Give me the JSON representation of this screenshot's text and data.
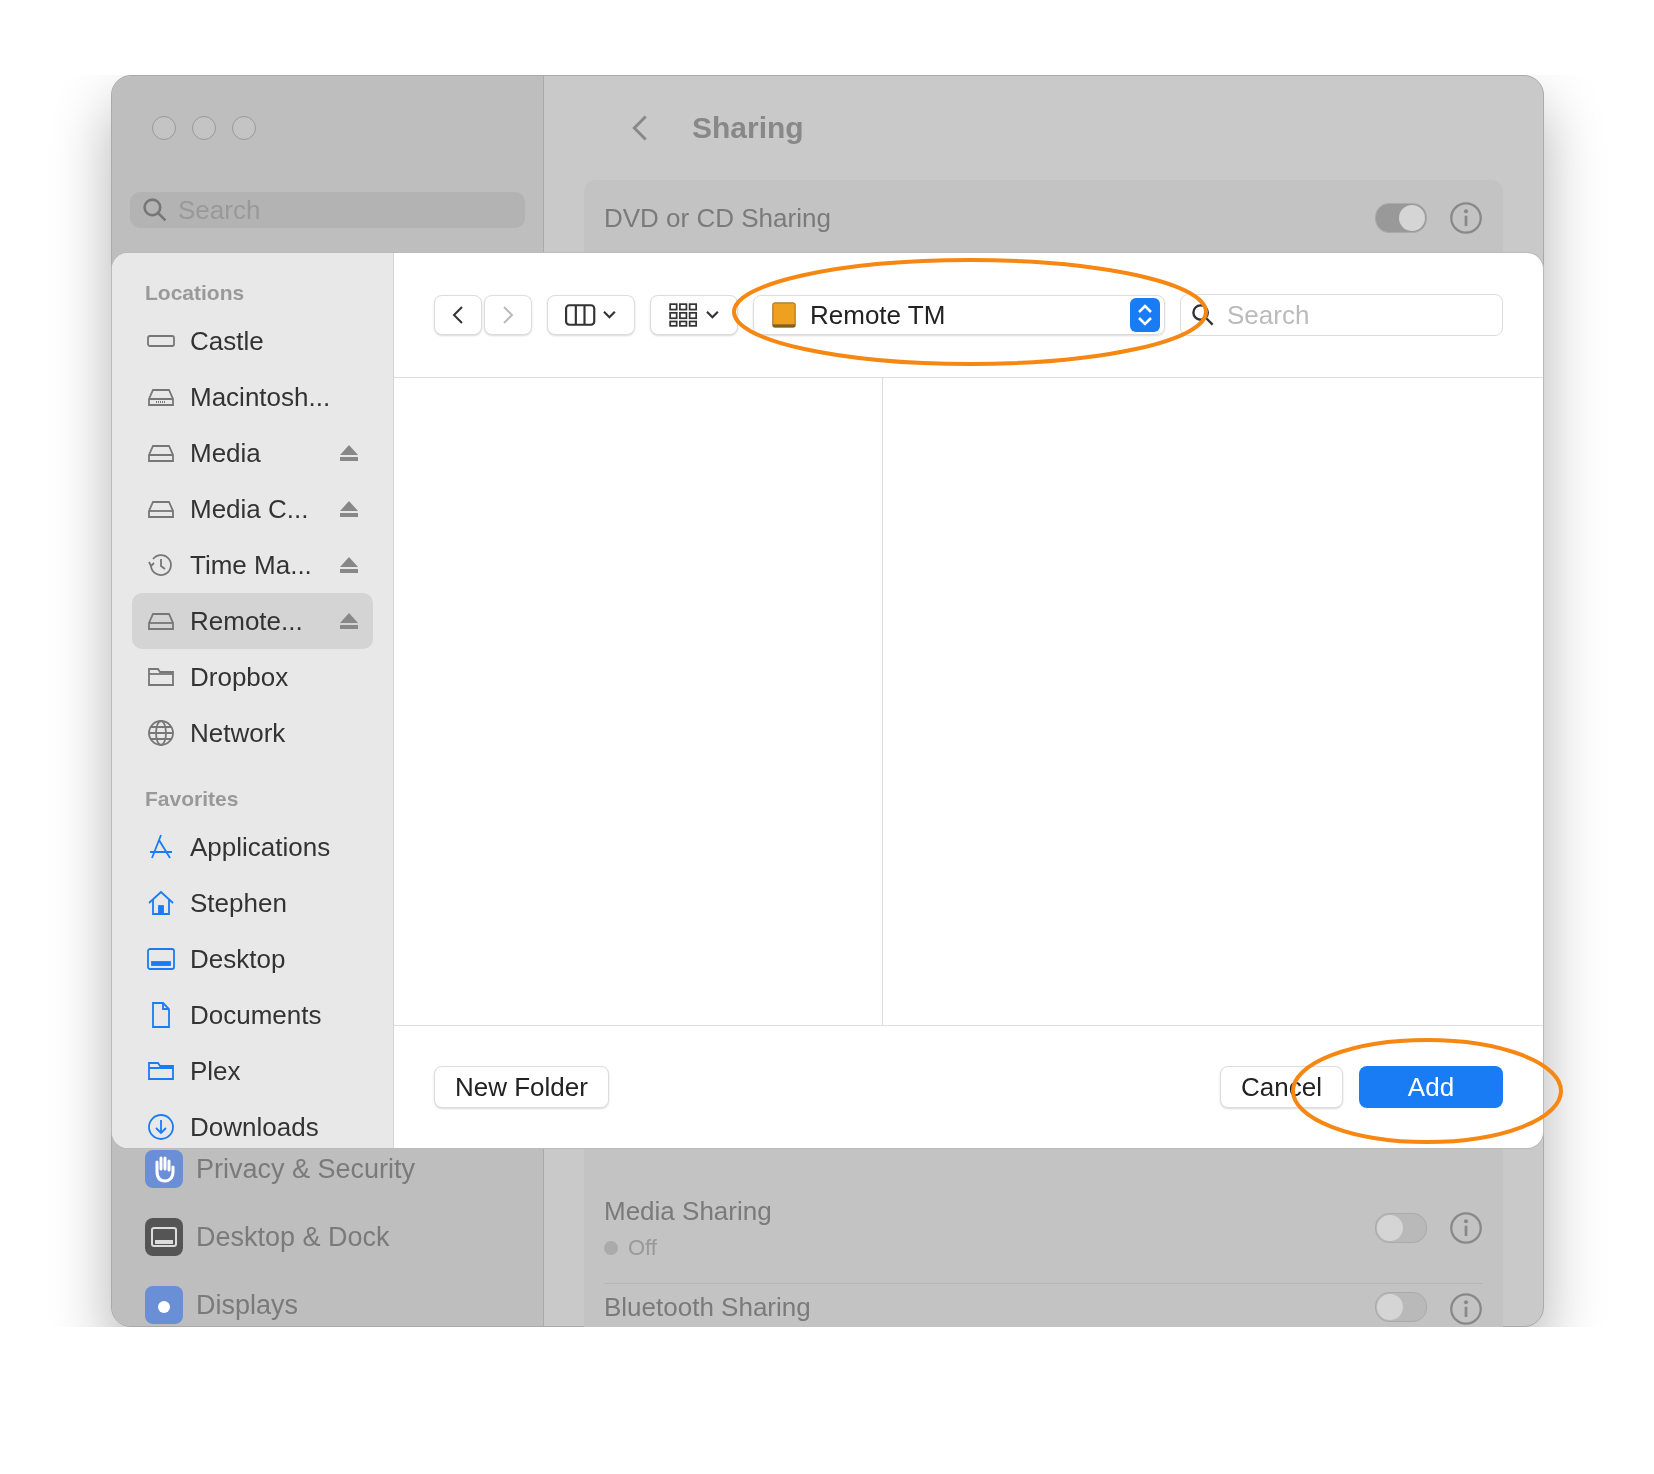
{
  "window": {
    "title": "Sharing",
    "search": {
      "placeholder": "Search"
    },
    "sidebar_items": [
      {
        "label": "Privacy & Security"
      },
      {
        "label": "Desktop & Dock"
      },
      {
        "label": "Displays"
      }
    ],
    "services": [
      {
        "name": "DVD or CD Sharing",
        "on": true
      },
      {
        "name": "Media Sharing",
        "on": false,
        "status": "Off"
      },
      {
        "name": "Bluetooth Sharing",
        "on": false
      }
    ]
  },
  "sheet": {
    "sections": [
      {
        "title": "Locations",
        "items": [
          {
            "label": "Castle",
            "eject": false,
            "selected": false
          },
          {
            "label": "Macintosh...",
            "eject": false,
            "selected": false
          },
          {
            "label": "Media",
            "eject": true,
            "selected": false
          },
          {
            "label": "Media C...",
            "eject": true,
            "selected": false
          },
          {
            "label": "Time Ma...",
            "eject": true,
            "selected": false
          },
          {
            "label": "Remote...",
            "eject": true,
            "selected": true
          },
          {
            "label": "Dropbox",
            "eject": false,
            "selected": false
          },
          {
            "label": "Network",
            "eject": false,
            "selected": false
          }
        ]
      },
      {
        "title": "Favorites",
        "items": [
          {
            "label": "Applications",
            "eject": false,
            "selected": false
          },
          {
            "label": "Stephen",
            "eject": false,
            "selected": false
          },
          {
            "label": "Desktop",
            "eject": false,
            "selected": false
          },
          {
            "label": "Documents",
            "eject": false,
            "selected": false
          },
          {
            "label": "Plex",
            "eject": false,
            "selected": false
          },
          {
            "label": "Downloads",
            "eject": false,
            "selected": false
          }
        ]
      }
    ],
    "location": "Remote TM",
    "search": {
      "placeholder": "Search"
    },
    "buttons": [
      {
        "label": "New Folder",
        "kind": "plain"
      },
      {
        "label": "Cancel",
        "kind": "plain"
      },
      {
        "label": "Add",
        "kind": "default"
      }
    ]
  }
}
